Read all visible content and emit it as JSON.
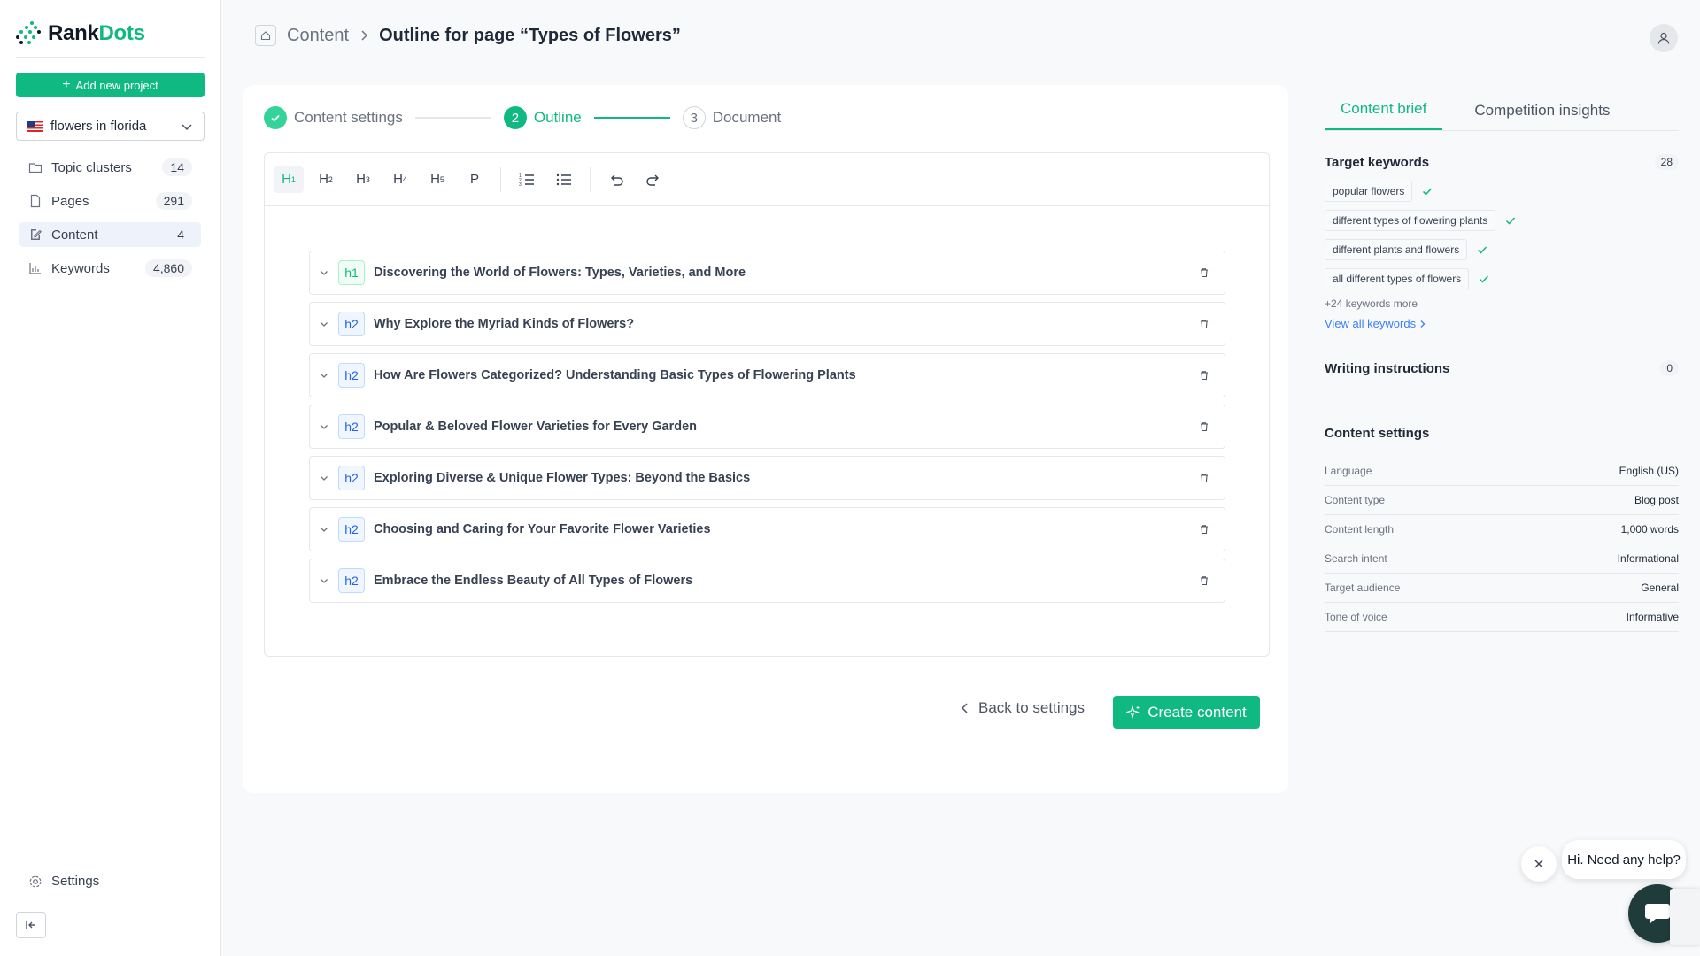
{
  "brand": {
    "part1": "Rank",
    "part2": "Dots"
  },
  "sidebar": {
    "add_project_label": "Add new project",
    "project_name": "flowers in florida",
    "items": [
      {
        "label": "Topic clusters",
        "count": "14",
        "icon": "folder-icon"
      },
      {
        "label": "Pages",
        "count": "291",
        "icon": "file-icon"
      },
      {
        "label": "Content",
        "count": "4",
        "icon": "edit-icon"
      },
      {
        "label": "Keywords",
        "count": "4,860",
        "icon": "chart-icon"
      }
    ],
    "settings_label": "Settings"
  },
  "header": {
    "crumb": "Content",
    "title": "Outline for page “Types of Flowers”"
  },
  "stepper": {
    "steps": [
      {
        "label": "Content settings",
        "number": ""
      },
      {
        "label": "Outline",
        "number": "2"
      },
      {
        "label": "Document",
        "number": "3"
      }
    ]
  },
  "toolbar": {
    "buttons": [
      {
        "main": "H",
        "sub": "1"
      },
      {
        "main": "H",
        "sub": "2"
      },
      {
        "main": "H",
        "sub": "3"
      },
      {
        "main": "H",
        "sub": "4"
      },
      {
        "main": "H",
        "sub": "5"
      },
      {
        "main": "P",
        "sub": ""
      }
    ]
  },
  "outline": [
    {
      "tag": "h1",
      "text": "Discovering the World of Flowers: Types, Varieties, and More"
    },
    {
      "tag": "h2",
      "text": "Why Explore the Myriad Kinds of Flowers?"
    },
    {
      "tag": "h2",
      "text": "How Are Flowers Categorized? Understanding Basic Types of Flowering Plants"
    },
    {
      "tag": "h2",
      "text": "Popular & Beloved Flower Varieties for Every Garden"
    },
    {
      "tag": "h2",
      "text": "Exploring Diverse & Unique Flower Types: Beyond the Basics"
    },
    {
      "tag": "h2",
      "text": "Choosing and Caring for Your Favorite Flower Varieties"
    },
    {
      "tag": "h2",
      "text": "Embrace the Endless Beauty of All Types of Flowers"
    }
  ],
  "actions": {
    "back_label": "Back to settings",
    "create_label": "Create content"
  },
  "right_panel": {
    "tabs": [
      "Content brief",
      "Competition insights"
    ],
    "target_keywords": {
      "title": "Target keywords",
      "count": "28",
      "items": [
        "popular flowers",
        "different types of flowering plants",
        "different plants and flowers",
        "all different types of flowers"
      ],
      "more": "+24 keywords more",
      "view_all": "View all keywords"
    },
    "writing_instructions": {
      "title": "Writing instructions",
      "count": "0"
    },
    "content_settings": {
      "title": "Content settings",
      "rows": [
        {
          "label": "Language",
          "value": "English (US)"
        },
        {
          "label": "Content type",
          "value": "Blog post"
        },
        {
          "label": "Content length",
          "value": "1,000 words"
        },
        {
          "label": "Search intent",
          "value": "Informational"
        },
        {
          "label": "Target audience",
          "value": "General"
        },
        {
          "label": "Tone of voice",
          "value": "Informative"
        }
      ]
    }
  },
  "chat": {
    "bubble_text": "Hi. Need any help?"
  },
  "colors": {
    "accent": "#10b981",
    "h2_tag": "#2563eb",
    "link": "#3b82f6"
  }
}
